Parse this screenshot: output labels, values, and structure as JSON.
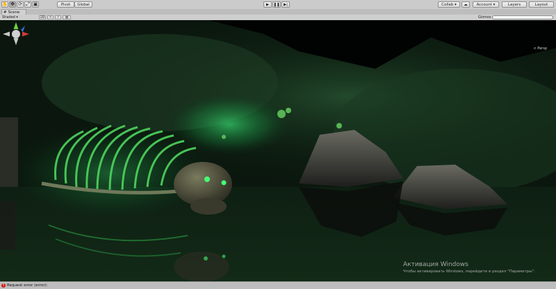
{
  "toolbar": {
    "tools": [
      {
        "name": "hand-tool",
        "glyph": "✋"
      },
      {
        "name": "move-tool",
        "glyph": "✥"
      },
      {
        "name": "rotate-tool",
        "glyph": "⟳"
      },
      {
        "name": "scale-tool",
        "glyph": "⤢"
      },
      {
        "name": "rect-tool",
        "glyph": "▣"
      }
    ],
    "pivot_label": "Pivot",
    "global_label": "Global",
    "play_glyph": "▶",
    "pause_glyph": "❚❚",
    "step_glyph": "▶|",
    "collab_label": "Collab ▾",
    "cloud_glyph": "☁",
    "account_label": "Account ▾",
    "layers_label": "Layers",
    "layout_label": "Layout"
  },
  "tab": {
    "icon": "#",
    "label": "Scene"
  },
  "scenebar": {
    "shading": "Shaded",
    "mode_2d": "2D",
    "lighting_glyph": "☼",
    "audio_glyph": "♪",
    "effects_glyph": "▧",
    "gizmos_label": "Gizmos ▾",
    "search_placeholder": "All"
  },
  "viewport": {
    "persp_label": "< Persp"
  },
  "watermark": {
    "title": "Активация Windows",
    "subtitle": "Чтобы активировать Windows, перейдите в раздел \"Параметры\"."
  },
  "status": {
    "error_text": "Request error (error):"
  },
  "colors": {
    "glow": "#2ee86a",
    "accent_red": "#d11111",
    "panel": "#cbcbcb"
  }
}
